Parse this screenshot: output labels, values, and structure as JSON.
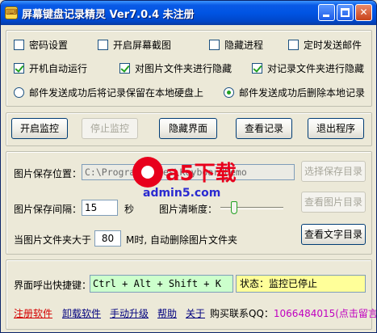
{
  "window": {
    "title": "屏幕键盘记录精灵  Ver7.0.4  未注册"
  },
  "options": {
    "password": "密码设置",
    "screenshot": "开启屏幕截图",
    "hide_process": "隐藏进程",
    "timed_email": "定时发送邮件",
    "autostart": "开机自动运行",
    "hide_image_folder": "对图片文件夹进行隐藏",
    "hide_record_folder": "对记录文件夹进行隐藏",
    "keep_local": "邮件发送成功后将记录保留在本地硬盘上",
    "delete_local": "邮件发送成功后删除本地记录"
  },
  "buttons": {
    "start_monitor": "开启监控",
    "stop_monitor": "停止监控",
    "hide_ui": "隐藏界面",
    "view_records": "查看记录",
    "exit": "退出程序",
    "choose_dir": "选择保存目录",
    "view_images": "查看图片目录",
    "view_text": "查看文字目录"
  },
  "image_settings": {
    "path_label": "图片保存位置：",
    "path_value": "C:\\Program Files\\KeyboardDemo",
    "interval_label": "图片保存间隔：",
    "interval_value": "15",
    "interval_unit": "秒",
    "clarity_label": "图片清晰度：",
    "clarity_level": 0.2,
    "size_label_prefix": "当图片文件夹大于",
    "size_value": "80",
    "size_label_suffix": "M时, 自动删除图片文件夹"
  },
  "hotkey": {
    "label": "界面呼出快捷键：",
    "value": "Ctrl + Alt + Shift + K",
    "status": "状态：监控已停止"
  },
  "footer": {
    "register": "注册软件",
    "uninstall": "卸载软件",
    "upgrade": "手动升级",
    "help": "帮助",
    "about": "关于",
    "qq_label": "购买联系QQ：",
    "qq_value": "1066484015(点击留言)"
  },
  "watermark": {
    "logo": "a5下载",
    "site": "admin5.com"
  },
  "colors": {
    "title_bar": "#0054e3",
    "hotkey_bg": "#ccffcc",
    "status_bg": "#ffff99",
    "link_red": "#d40000",
    "link_blue": "#00007f",
    "qq_color": "#c000c0"
  }
}
